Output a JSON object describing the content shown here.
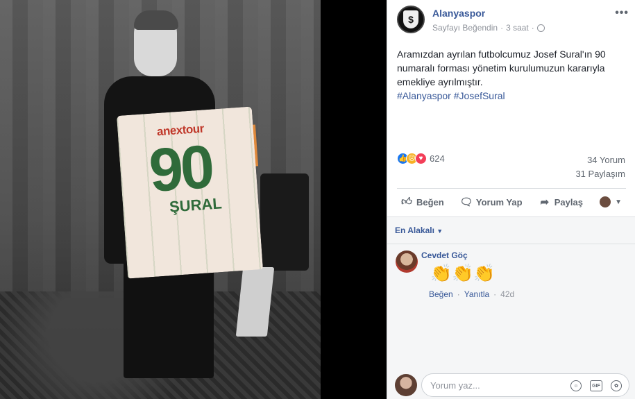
{
  "photo": {
    "sponsor": "anextour",
    "number": "90",
    "player_name": "ŞURAL"
  },
  "post": {
    "page_name": "Alanyaspor",
    "liked_status": "Sayfayı Beğendin",
    "time_ago": "3 saat",
    "text": "Aramızdan ayrılan futbolcumuz Josef Sural'ın 90 numaralı forması yönetim kurulumuzun kararıyla emekliye ayrılmıştır.",
    "hashtags": "#Alanyaspor #JosefSural",
    "reaction_count": "624",
    "comment_count": "34 Yorum",
    "share_count": "31 Paylaşım"
  },
  "actions": {
    "like": "Beğen",
    "comment": "Yorum Yap",
    "share": "Paylaş"
  },
  "comments": {
    "sort_label": "En Alakalı",
    "items": [
      {
        "author": "Cevdet Göç",
        "emoji": "👏👏👏",
        "like_label": "Beğen",
        "reply_label": "Yanıtla",
        "time": "42d"
      }
    ]
  },
  "composer": {
    "placeholder": "Yorum yaz...",
    "icons": [
      "emoji-icon",
      "gif-icon",
      "sticker-icon"
    ]
  },
  "colors": {
    "link": "#385898",
    "text": "#1d2129",
    "meta": "#90949c",
    "like_blue": "#1877f2",
    "love_red": "#f33e58",
    "sad_yellow": "#f7b125"
  }
}
